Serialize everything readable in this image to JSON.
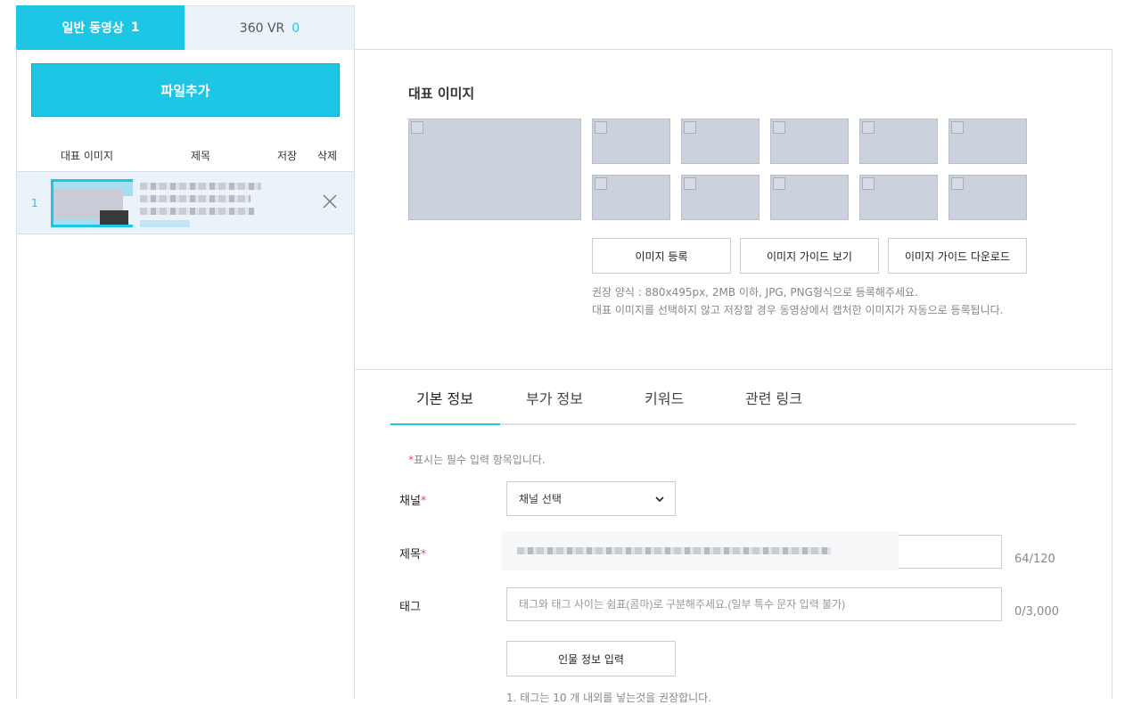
{
  "top_tabs": {
    "normal": {
      "label": "일반 동영상",
      "count": "1"
    },
    "vr": {
      "label": "360 VR",
      "count": "0"
    }
  },
  "left": {
    "add_file_label": "파일추가",
    "columns": {
      "thumb": "대표 이미지",
      "title": "제목",
      "save": "저장",
      "delete": "삭제"
    },
    "rows": [
      {
        "index": "1"
      }
    ]
  },
  "thumbnail_section": {
    "title": "대표 이미지",
    "buttons": {
      "register": "이미지 등록",
      "guide_view": "이미지 가이드 보기",
      "guide_download": "이미지 가이드 다운로드"
    },
    "hint_line1": "권장 양식 : 880x495px, 2MB 이하, JPG, PNG형식으로 등록해주세요.",
    "hint_line2": "대표 이미지를 선택하지 않고 저장할 경우 동영상에서 캡처한 이미지가 자동으로 등록됩니다."
  },
  "info_tabs": [
    "기본 정보",
    "부가 정보",
    "키워드",
    "관련 링크"
  ],
  "form": {
    "required_note": "표시는 필수 입력 항목입니다.",
    "required_star": "*",
    "channel": {
      "label": "채널",
      "selected": "채널 선택"
    },
    "title": {
      "label": "제목",
      "counter": "64/120"
    },
    "tag": {
      "label": "태그",
      "placeholder": "태그와 태그 사이는 쉼표(콤마)로 구분해주세요.(일부 특수 문자 입력 불가)",
      "counter": "0/3,000"
    },
    "person_button": "인물 정보 입력",
    "tag_hint": "1. 태그는 10 개 내외를 넣는것을 권장합니다."
  },
  "colors": {
    "accent": "#1ec6e6",
    "required": "#e0506b",
    "row_bg": "#eaf2fa"
  },
  "icons": {
    "delete": "close-icon",
    "select": "chevron-down-icon",
    "slot": "checkbox-icon"
  }
}
